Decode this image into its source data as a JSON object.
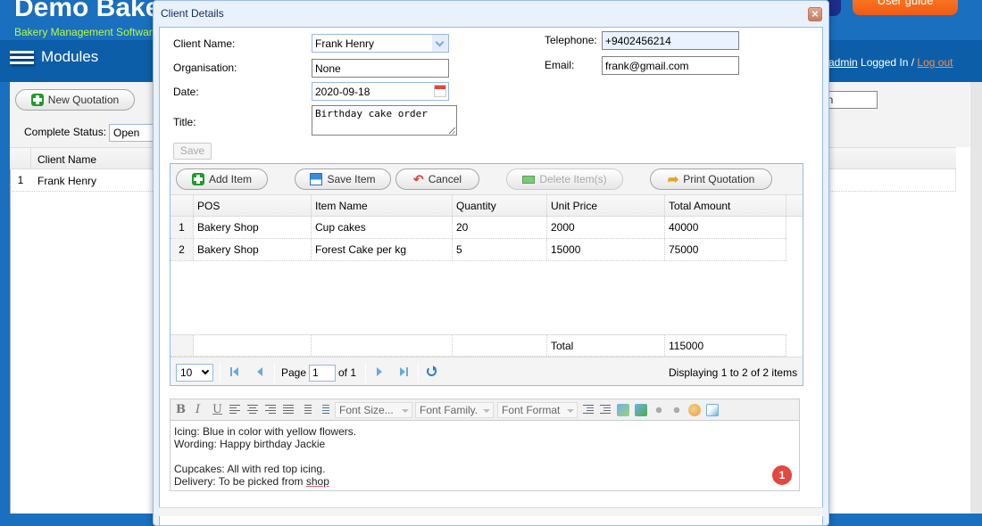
{
  "app": {
    "title": "Demo Bakery",
    "subtitle": "Bakery Management Software",
    "user_guide_label": "User guide",
    "modules_label": "Modules",
    "login": {
      "user": "admin",
      "logged_in_text": " Logged In / ",
      "logout_label": "Log out"
    }
  },
  "background": {
    "new_quotation_label": "New Quotation",
    "complete_status_label": "Complete Status:",
    "complete_status_value": "Open",
    "search_value": "on",
    "grid": {
      "header": "Client Name",
      "rows": [
        {
          "num": "1",
          "client_name": "Frank Henry"
        }
      ]
    }
  },
  "dialog": {
    "title": "Client Details",
    "close_label": "×",
    "form": {
      "client_name_label": "Client Name:",
      "client_name_value": "Frank Henry",
      "organisation_label": "Organisation:",
      "organisation_value": "None",
      "date_label": "Date:",
      "date_value": "2020-09-18",
      "title_label": "Title:",
      "title_value": "Birthday cake order",
      "telephone_label": "Telephone:",
      "telephone_value": "+9402456214",
      "email_label": "Email:",
      "email_value": "frank@gmail.com",
      "save_label": "Save"
    },
    "items_toolbar": {
      "add_item": "Add Item",
      "save_item": "Save Item",
      "cancel": "Cancel",
      "delete_items": "Delete Item(s)",
      "print_quotation": "Print Quotation"
    },
    "items_grid": {
      "columns": [
        "POS",
        "Item Name",
        "Quantity",
        "Unit Price",
        "Total Amount"
      ],
      "rows": [
        {
          "num": "1",
          "pos": "Bakery Shop",
          "item_name": "Cup cakes",
          "quantity": "20",
          "unit_price": "2000",
          "total_amount": "40000"
        },
        {
          "num": "2",
          "pos": "Bakery Shop",
          "item_name": "Forest Cake per kg",
          "quantity": "5",
          "unit_price": "15000",
          "total_amount": "75000"
        }
      ],
      "footer": {
        "label": "Total",
        "value": "115000"
      }
    },
    "pager": {
      "page_size": "10",
      "page_label": "Page",
      "page_value": "1",
      "of_label": "of 1",
      "display_text": "Displaying 1 to 2 of 2 items"
    },
    "editor": {
      "bold": "B",
      "italic": "I",
      "underline": "U",
      "font_size": "Font Size...",
      "font_family": "Font Family.",
      "font_format": "Font Format",
      "lines": [
        "Icing: Blue in color with yellow flowers.",
        "Wording: Happy birthday Jackie",
        "",
        "Cupcakes: All with red top icing.",
        "Delivery: To be picked from "
      ],
      "misspelled_word": "shop"
    },
    "notification_count": "1"
  }
}
